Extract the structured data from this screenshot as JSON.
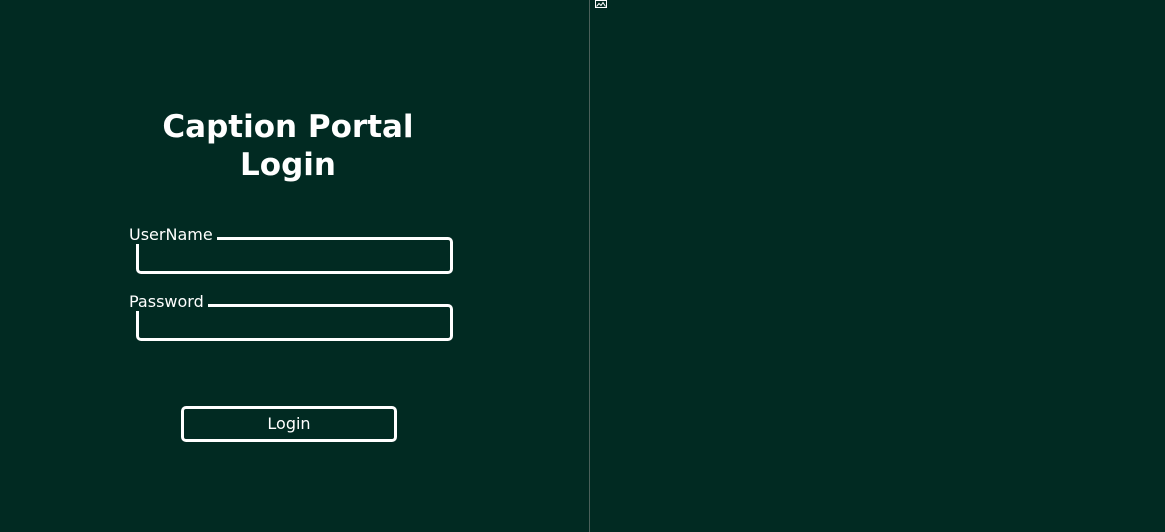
{
  "login_form": {
    "title": "Caption Portal Login",
    "username_label": "UserName",
    "username_value": "",
    "password_label": "Password",
    "password_value": "",
    "login_button_label": "Login"
  },
  "right_panel": {
    "image_icon": "broken-image-icon"
  },
  "colors": {
    "background": "#012a22",
    "foreground": "#ffffff",
    "divider": "#4a605a"
  }
}
